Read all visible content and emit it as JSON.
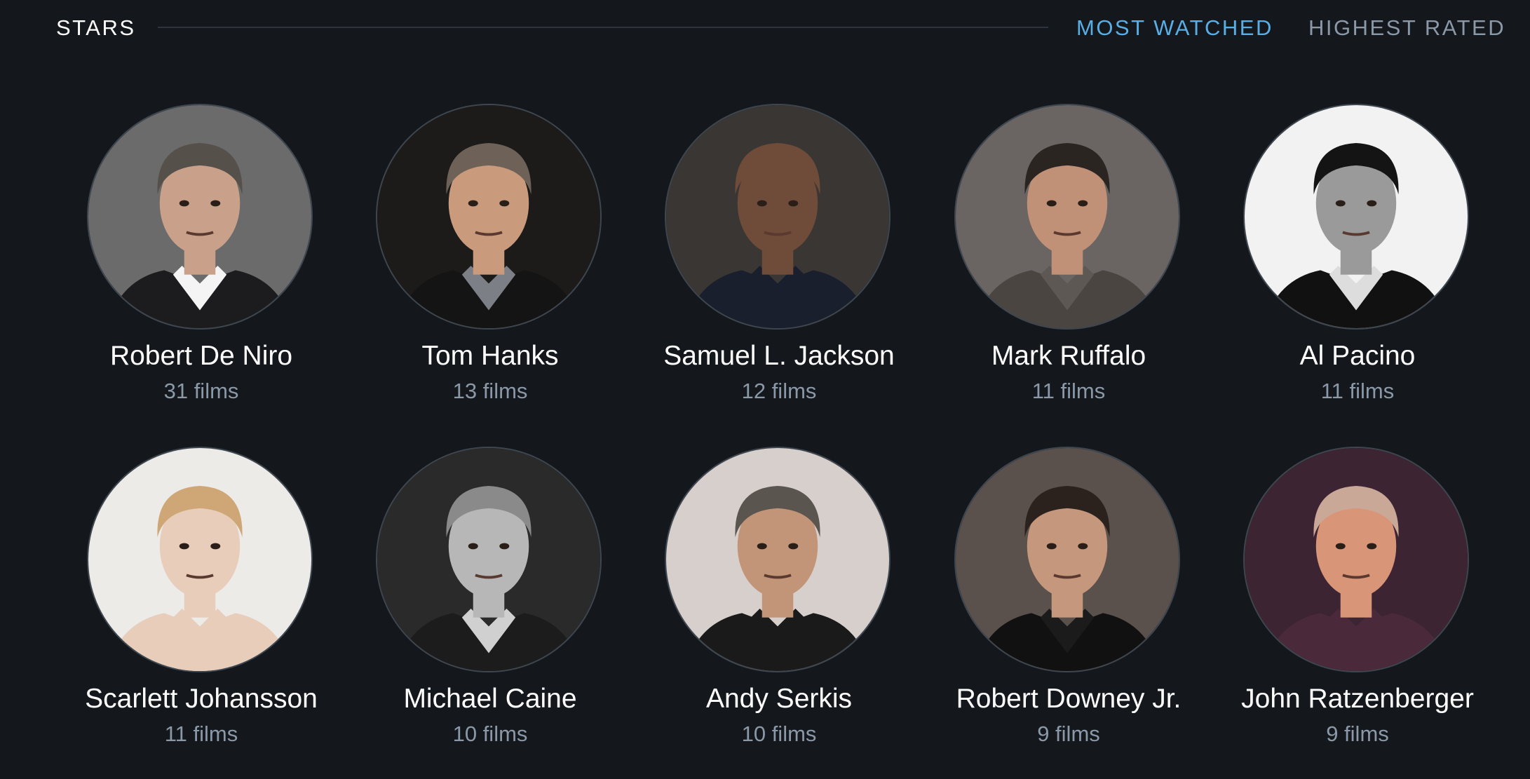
{
  "header": {
    "title": "STARS",
    "tabs": [
      {
        "label": "MOST WATCHED",
        "active": true,
        "color": "#5aaee6"
      },
      {
        "label": "HIGHEST RATED",
        "active": false,
        "color": "#8a98a8"
      }
    ]
  },
  "stars": [
    {
      "name": "Robert De Niro",
      "films": "31 films",
      "bg": "#6b6b6b",
      "skin": "#c9a08a",
      "hair": "#55504a",
      "shirt": "#f4f4f4",
      "jacket": "#1c1c1e"
    },
    {
      "name": "Tom Hanks",
      "films": "13 films",
      "bg": "#1d1b1a",
      "skin": "#c99a7c",
      "hair": "#6e6258",
      "shirt": "#7c7f86",
      "jacket": "#141414"
    },
    {
      "name": "Samuel L. Jackson",
      "films": "12 films",
      "bg": "#3a3633",
      "skin": "#6f4b3a",
      "hair": "#6f4b3a",
      "shirt": "#1a1f2e",
      "jacket": "#1a1f2e"
    },
    {
      "name": "Mark Ruffalo",
      "films": "11 films",
      "bg": "#6a6562",
      "skin": "#c09077",
      "hair": "#2b2522",
      "shirt": "#5d5853",
      "jacket": "#4a4541"
    },
    {
      "name": "Al Pacino",
      "films": "11 films",
      "bg": "#f2f2f2",
      "skin": "#9a9a9a",
      "hair": "#141414",
      "shirt": "#dddddd",
      "jacket": "#111111"
    },
    {
      "name": "Scarlett Johansson",
      "films": "11 films",
      "bg": "#ecebe8",
      "skin": "#e8cdbb",
      "hair": "#cfa777",
      "shirt": "#e8cdbb",
      "jacket": "#e8cdbb"
    },
    {
      "name": "Michael Caine",
      "films": "10 films",
      "bg": "#2a2a2a",
      "skin": "#b7b7b7",
      "hair": "#8a8a8a",
      "shirt": "#d0d0d0",
      "jacket": "#1c1c1c"
    },
    {
      "name": "Andy Serkis",
      "films": "10 films",
      "bg": "#d7cfcc",
      "skin": "#c29478",
      "hair": "#5a554f",
      "shirt": "#1a1a1a",
      "jacket": "#1a1a1a"
    },
    {
      "name": "Robert Downey Jr.",
      "films": "9 films",
      "bg": "#5b514c",
      "skin": "#c5977c",
      "hair": "#2b221e",
      "shirt": "#1b1b1b",
      "jacket": "#111111"
    },
    {
      "name": "John Ratzenberger",
      "films": "9 films",
      "bg": "#3d2432",
      "skin": "#d99578",
      "hair": "#c9a898",
      "shirt": "#4a2a3a",
      "jacket": "#4a2a3a"
    }
  ]
}
